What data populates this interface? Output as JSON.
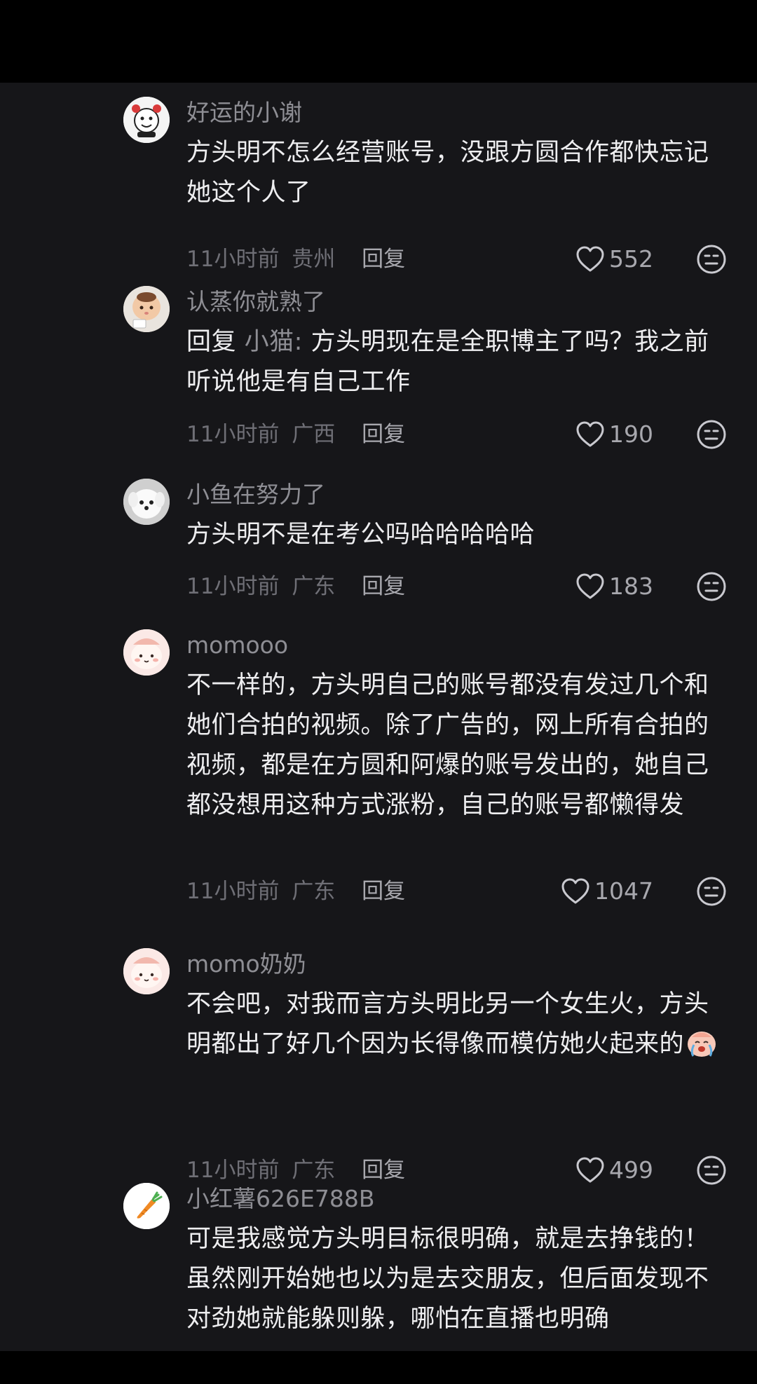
{
  "comments": [
    {
      "username": "好运的小谢",
      "text": "方头明不怎么经营账号，没跟方圆合作都快忘记她这个人了",
      "time": "11小时前",
      "location": "贵州",
      "reply_label": "回复",
      "likes": "552",
      "avatar": "cartoon-face-avatar"
    },
    {
      "username": "认蒸你就熟了",
      "reply_prefix": "回复",
      "reply_to": "小猫:",
      "text": "方头明现在是全职博主了吗？我之前听说他是有自己工作",
      "time": "11小时前",
      "location": "广西",
      "reply_label": "回复",
      "likes": "190",
      "avatar": "steamed-bun-avatar"
    },
    {
      "username": "小鱼在努力了",
      "text": "方头明不是在考公吗哈哈哈哈哈",
      "time": "11小时前",
      "location": "广东",
      "reply_label": "回复",
      "likes": "183",
      "avatar": "white-puppy-avatar"
    },
    {
      "username": "momooo",
      "text": "不一样的，方头明自己的账号都没有发过几个和她们合拍的视频。除了广告的，网上所有合拍的视频，都是在方圆和阿爆的账号发出的，她自己都没想用这种方式涨粉，自己的账号都懒得发",
      "time": "11小时前",
      "location": "广东",
      "reply_label": "回复",
      "likes": "1047",
      "avatar": "pink-bunny-avatar"
    },
    {
      "username": "momo奶奶",
      "text": "不会吧，对我而言方头明比另一个女生火，方头明都出了好几个因为长得像而模仿她火起来的",
      "inline_emoji": "crying-face-emoji",
      "time": "11小时前",
      "location": "广东",
      "reply_label": "回复",
      "likes": "499",
      "avatar": "pink-bunny-avatar"
    },
    {
      "username": "小红薯626E788B",
      "text": "可是我感觉方头明目标很明确，就是去挣钱的！虽然刚开始她也以为是去交朋友，但后面发现不对劲她就能躲则躲，哪怕在直播也明确",
      "avatar": "carrot-avatar"
    }
  ],
  "colors": {
    "background": "#000000",
    "panel": "#161619",
    "text_primary": "#eeeef0",
    "text_secondary": "#8e8e94",
    "text_meta": "#6f6f76"
  },
  "icons": {
    "like": "heart-outline-icon",
    "react": "neutral-face-icon"
  }
}
